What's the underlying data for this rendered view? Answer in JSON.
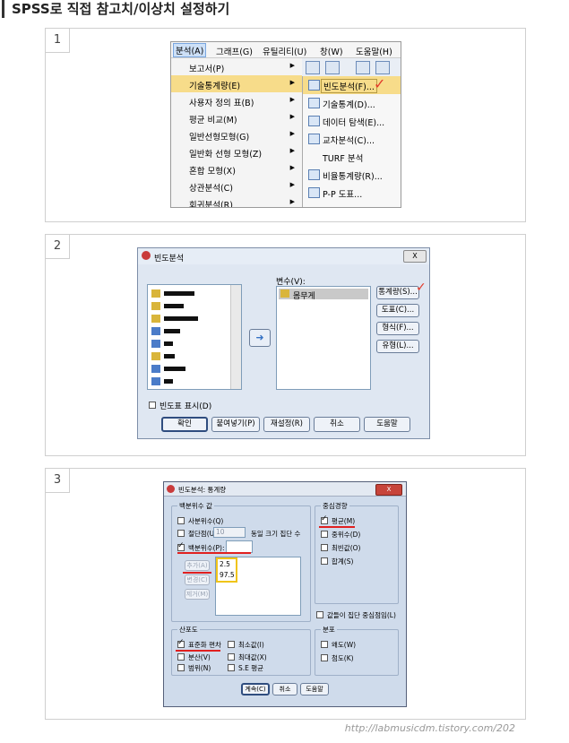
{
  "page_title": "SPSS로 직접 참고치/이상치 설정하기",
  "panels": [
    {
      "number": "1"
    },
    {
      "number": "2"
    },
    {
      "number": "3"
    }
  ],
  "colors": {
    "check_mark": "#e23a2a",
    "highlight": "#f7dc8a",
    "annotation_box": "#f0c419",
    "underline": "#e02020"
  },
  "menu": {
    "bar": [
      "분석(A)",
      "그래프(G)",
      "유틸리티(U)",
      "창(W)",
      "도움말(H)"
    ],
    "items": [
      "보고서(P)",
      "기술통계량(E)",
      "사용자 정의 표(B)",
      "평균 비교(M)",
      "일반선형모형(G)",
      "일반화 선형 모형(Z)",
      "혼합 모형(X)",
      "상관분석(C)",
      "회귀분석(R)"
    ],
    "submenu": [
      "빈도분석(F)...",
      "기술통계(D)...",
      "데이터 탐색(E)...",
      "교차분석(C)...",
      "TURF 분석",
      "비율통계량(R)...",
      "P-P 도표..."
    ]
  },
  "freq_dialog": {
    "title": "빈도분석",
    "close": "X",
    "variables_label": "변수(V):",
    "selected_variable": "몸무게",
    "side_buttons": [
      "통계량(S)...",
      "도표(C)...",
      "형식(F)...",
      "유형(L)..."
    ],
    "display_table_label": "빈도표 표시(D)",
    "bottom_buttons": [
      "확인",
      "붙여넣기(P)",
      "재설정(R)",
      "취소",
      "도움말"
    ]
  },
  "stats_dialog": {
    "title": "빈도분석: 통계량",
    "close": "X",
    "percentile": {
      "group": "백분위수 값",
      "quartiles": "사분위수(Q)",
      "cutpoints": "절단점(U):",
      "cutpoints_value": "10",
      "cutpoints_suffix": "동일 크기 집단 수",
      "percentiles": "백분위수(P):",
      "buttons": [
        "추가(A)",
        "변경(C)",
        "제거(M)"
      ],
      "values": [
        "2.5",
        "97.5"
      ]
    },
    "central": {
      "group": "중심경향",
      "items": [
        "평균(M)",
        "중위수(D)",
        "최빈값(O)",
        "합계(S)"
      ],
      "midpoints": "값들이 집단 중심점임(L)"
    },
    "dispersion": {
      "group": "산포도",
      "items": [
        "표준화 편차",
        "최소값(I)",
        "분산(V)",
        "최대값(X)",
        "범위(N)",
        "S.E 평균"
      ]
    },
    "distribution": {
      "group": "분포",
      "items": [
        "왜도(W)",
        "첨도(K)"
      ]
    },
    "buttons": [
      "계속(C)",
      "취소",
      "도움말"
    ]
  },
  "footer_url": "http://labmusicdm.tistory.com/202"
}
